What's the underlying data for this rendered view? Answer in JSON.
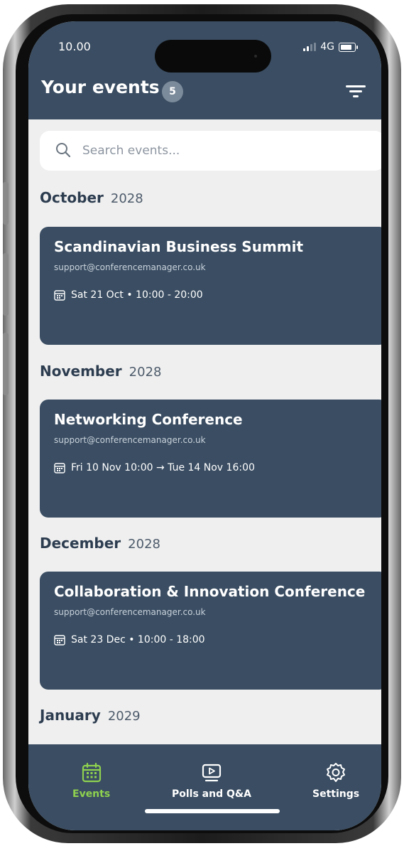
{
  "status_bar": {
    "time": "10.00",
    "network": "4G"
  },
  "header": {
    "title": "Your events",
    "count": "5"
  },
  "search": {
    "placeholder": "Search events..."
  },
  "months": [
    {
      "name": "October",
      "year": "2028"
    },
    {
      "name": "November",
      "year": "2028"
    },
    {
      "name": "December",
      "year": "2028"
    },
    {
      "name": "January",
      "year": "2029"
    }
  ],
  "events": [
    {
      "title": "Scandinavian Business Summit",
      "email": "support@conferencemanager.co.uk",
      "date": "Sat 21 Oct • 10:00 - 20:00"
    },
    {
      "title": "Networking Conference",
      "email": "support@conferencemanager.co.uk",
      "date": "Fri 10 Nov 10:00 → Tue 14 Nov 16:00"
    },
    {
      "title": "Collaboration & Innovation Conference",
      "email": "support@conferencemanager.co.uk",
      "date": "Sat 23 Dec • 10:00 - 18:00"
    }
  ],
  "nav": {
    "events": "Events",
    "polls": "Polls and Q&A",
    "settings": "Settings"
  },
  "colors": {
    "primary": "#3a4d62",
    "background": "#efefef",
    "active": "#8fd14f"
  },
  "icons": [
    "filter-icon",
    "search-icon",
    "calendar-icon",
    "poll-icon",
    "gear-icon"
  ]
}
